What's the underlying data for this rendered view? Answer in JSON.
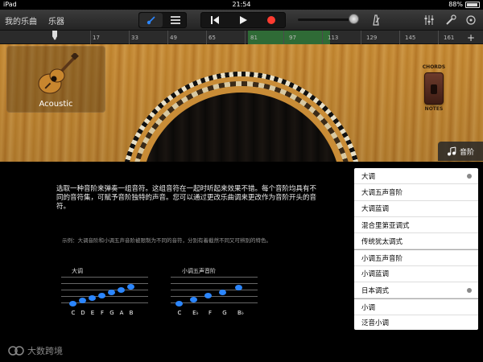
{
  "status_bar": {
    "carrier": "iPad",
    "time": "21:54",
    "battery": "88%"
  },
  "toolbar": {
    "my_songs": "我的乐曲",
    "instruments": "乐器",
    "icons": [
      "guitar-view-icon",
      "tracks-view-icon",
      "rewind-icon",
      "play-icon",
      "record-icon",
      "volume-slider",
      "metronome-icon",
      "mixer-icon",
      "settings-wrench-icon",
      "loops-icon"
    ]
  },
  "ruler": {
    "ticks": [
      "1",
      "17",
      "33",
      "49",
      "65",
      "81",
      "97",
      "113",
      "129",
      "145",
      "161"
    ]
  },
  "instrument": {
    "name": "Acoustic"
  },
  "switch": {
    "top_label": "CHORDS",
    "bottom_label": "NOTES"
  },
  "scale_button": {
    "label": "音阶"
  },
  "panel": {
    "description": "选取一种音阶来弹奏一组音符。这组音符在一起时听起来效果不错。每个音阶均具有不同的音符集，可赋予音阶独特的声音。您可以通过更改乐曲调来更改作为音阶开头的音符。",
    "example": "示例：大调音阶和小调五声音阶被限制为不同的音符，分别有着截然不同又可辨别的特色。",
    "staff1": {
      "title": "大调",
      "notes": [
        "C",
        "D",
        "E",
        "F",
        "G",
        "A",
        "B"
      ]
    },
    "staff2": {
      "title": "小调五声音阶",
      "notes": [
        "C",
        "E♭",
        "F",
        "G",
        "B♭"
      ]
    }
  },
  "scale_menu": {
    "items": [
      {
        "label": "大调",
        "marked": true,
        "group_start": false
      },
      {
        "label": "大调五声音阶",
        "marked": false,
        "group_start": false
      },
      {
        "label": "大调蓝调",
        "marked": false,
        "group_start": false
      },
      {
        "label": "混合里第亚调式",
        "marked": false,
        "group_start": false
      },
      {
        "label": "传统犹太调式",
        "marked": false,
        "group_start": false
      },
      {
        "label": "小调五声音阶",
        "marked": false,
        "group_start": true
      },
      {
        "label": "小调蓝调",
        "marked": false,
        "group_start": false
      },
      {
        "label": "日本调式",
        "marked": true,
        "group_start": false
      },
      {
        "label": "小调",
        "marked": false,
        "group_start": true
      },
      {
        "label": "泛音小调",
        "marked": false,
        "group_start": false
      }
    ]
  },
  "watermark": {
    "text": "大数跨境"
  },
  "colors": {
    "accent_blue": "#2b86ff",
    "record_red": "#ff3b30",
    "loop_green": "#2f6b36"
  }
}
